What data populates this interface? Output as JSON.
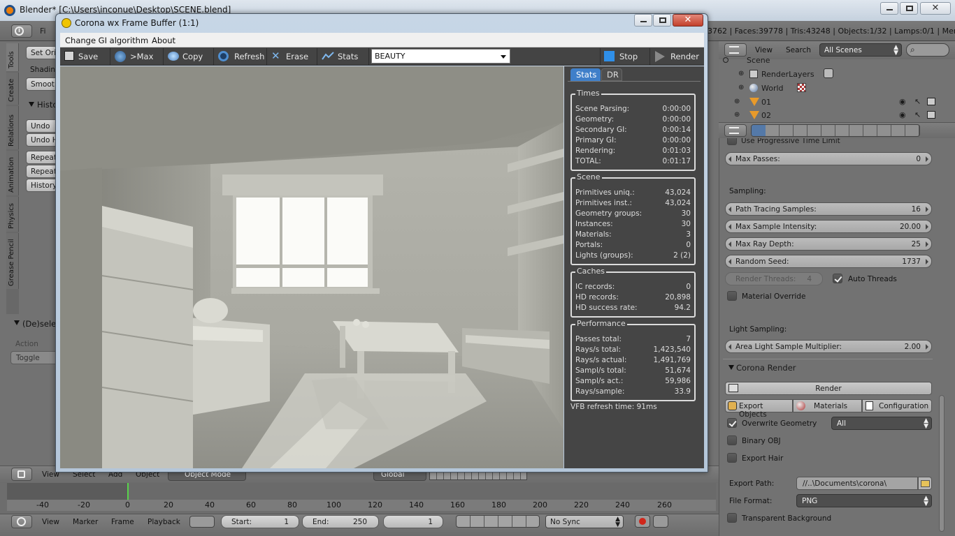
{
  "blender": {
    "title": "Blender* [C:\\Users\\inconue\\Desktop\\SCENE.blend]",
    "info_label": "Fi",
    "stats_text": "3762 | Faces:39778 | Tris:43248 | Objects:1/32 | Lamps:0/1 | Mem:5",
    "toolshelf": {
      "tabs": [
        "Tools",
        "Create",
        "Relations",
        "Animation",
        "Physics",
        "Grease Pencil"
      ],
      "set_origin": "Set Ori",
      "shading": "Shadin",
      "smooth": "Smoot",
      "history_header": "Histo",
      "undo": "Undo",
      "undo_history": "Undo H",
      "repeat": "Repeat",
      "repeat_history": "Repeat",
      "history": "History",
      "deselect_header": "(De)sele",
      "action_label": "Action",
      "toggle": "Toggle"
    },
    "viewport_header": {
      "view": "View",
      "select": "Select",
      "add": "Add",
      "object": "Object",
      "mode": "Object Mode",
      "orientation": "Global"
    },
    "timeline": {
      "ticks": [
        "-40",
        "-20",
        "0",
        "20",
        "40",
        "60",
        "80",
        "100",
        "120",
        "140",
        "160",
        "180",
        "200",
        "220",
        "240",
        "260"
      ],
      "current_frame_marker": 0,
      "view": "View",
      "marker": "Marker",
      "frame": "Frame",
      "playback": "Playback",
      "start_label": "Start:",
      "start_value": "1",
      "end_label": "End:",
      "end_value": "250",
      "current_frame": "1",
      "sync": "No Sync"
    },
    "outliner": {
      "view": "View",
      "search": "Search",
      "scenes_select": "All Scenes",
      "items": [
        {
          "label": "Scene",
          "icon": "scene-icon"
        },
        {
          "label": "RenderLayers",
          "icon": "renderlayers-icon"
        },
        {
          "label": "World",
          "icon": "world-icon"
        },
        {
          "label": "01",
          "icon": "mesh-icon"
        },
        {
          "label": "02",
          "icon": "mesh-icon"
        }
      ]
    },
    "properties": {
      "progressive_time_limit": "Use Progressive Time Limit",
      "max_passes_label": "Max Passes:",
      "max_passes_value": "0",
      "sampling_header": "Sampling:",
      "path_tracing_label": "Path Tracing Samples:",
      "path_tracing_value": "16",
      "max_sample_intensity_label": "Max Sample Intensity:",
      "max_sample_intensity_value": "20.00",
      "max_ray_depth_label": "Max Ray Depth:",
      "max_ray_depth_value": "25",
      "random_seed_label": "Random Seed:",
      "random_seed_value": "1737",
      "render_threads_label": "Render Threads:",
      "render_threads_value": "4",
      "auto_threads": "Auto Threads",
      "material_override": "Material Override",
      "light_sampling_header": "Light Sampling:",
      "area_light_label": "Area Light Sample Multiplier:",
      "area_light_value": "2.00",
      "corona_render_header": "Corona Render",
      "render_button": "Render",
      "export_objects": "Export Objects",
      "materials": "Materials",
      "configuration": "Configuration",
      "overwrite_geometry": "Overwrite Geometry",
      "overwrite_select": "All",
      "binary_obj": "Binary OBJ",
      "export_hair": "Export Hair",
      "export_path_label": "Export Path:",
      "export_path_value": "//..\\Documents\\corona\\",
      "file_format_label": "File Format:",
      "file_format_value": "PNG",
      "transparent_background": "Transparent Background"
    }
  },
  "corona": {
    "title": "Corona wx Frame Buffer (1:1)",
    "menu": [
      "Change GI algorithm",
      "About"
    ],
    "toolbar": {
      "save": "Save",
      "max": ">Max",
      "copy": "Copy",
      "refresh": "Refresh",
      "erase": "Erase",
      "stats": "Stats",
      "channel": "BEAUTY",
      "stop": "Stop",
      "render": "Render"
    },
    "tabs": [
      "Stats",
      "DR"
    ],
    "stats": {
      "times": {
        "header": "Times",
        "rows": [
          {
            "k": "Scene Parsing:",
            "v": "0:00:00"
          },
          {
            "k": "Geometry:",
            "v": "0:00:00"
          },
          {
            "k": "Secondary GI:",
            "v": "0:00:14"
          },
          {
            "k": "Primary GI:",
            "v": "0:00:00"
          },
          {
            "k": "Rendering:",
            "v": "0:01:03"
          },
          {
            "k": "TOTAL:",
            "v": "0:01:17"
          }
        ]
      },
      "scene": {
        "header": "Scene",
        "rows": [
          {
            "k": "Primitives uniq.:",
            "v": "43,024"
          },
          {
            "k": "Primitives inst.:",
            "v": "43,024"
          },
          {
            "k": "Geometry groups:",
            "v": "30"
          },
          {
            "k": "Instances:",
            "v": "30"
          },
          {
            "k": "Materials:",
            "v": "3"
          },
          {
            "k": "Portals:",
            "v": "0"
          },
          {
            "k": "Lights (groups):",
            "v": "2 (2)"
          }
        ]
      },
      "caches": {
        "header": "Caches",
        "rows": [
          {
            "k": "IC records:",
            "v": "0"
          },
          {
            "k": "HD records:",
            "v": "20,898"
          },
          {
            "k": "HD success rate:",
            "v": "94.2"
          }
        ]
      },
      "performance": {
        "header": "Performance",
        "rows": [
          {
            "k": "Passes total:",
            "v": "7"
          },
          {
            "k": "Rays/s total:",
            "v": "1,423,540"
          },
          {
            "k": "Rays/s actual:",
            "v": "1,491,769"
          },
          {
            "k": "Sampl/s total:",
            "v": "51,674"
          },
          {
            "k": "Sampl/s act.:",
            "v": "59,986"
          },
          {
            "k": "Rays/sample:",
            "v": "33.9"
          }
        ]
      },
      "refresh_time": "VFB refresh time: 91ms"
    }
  }
}
